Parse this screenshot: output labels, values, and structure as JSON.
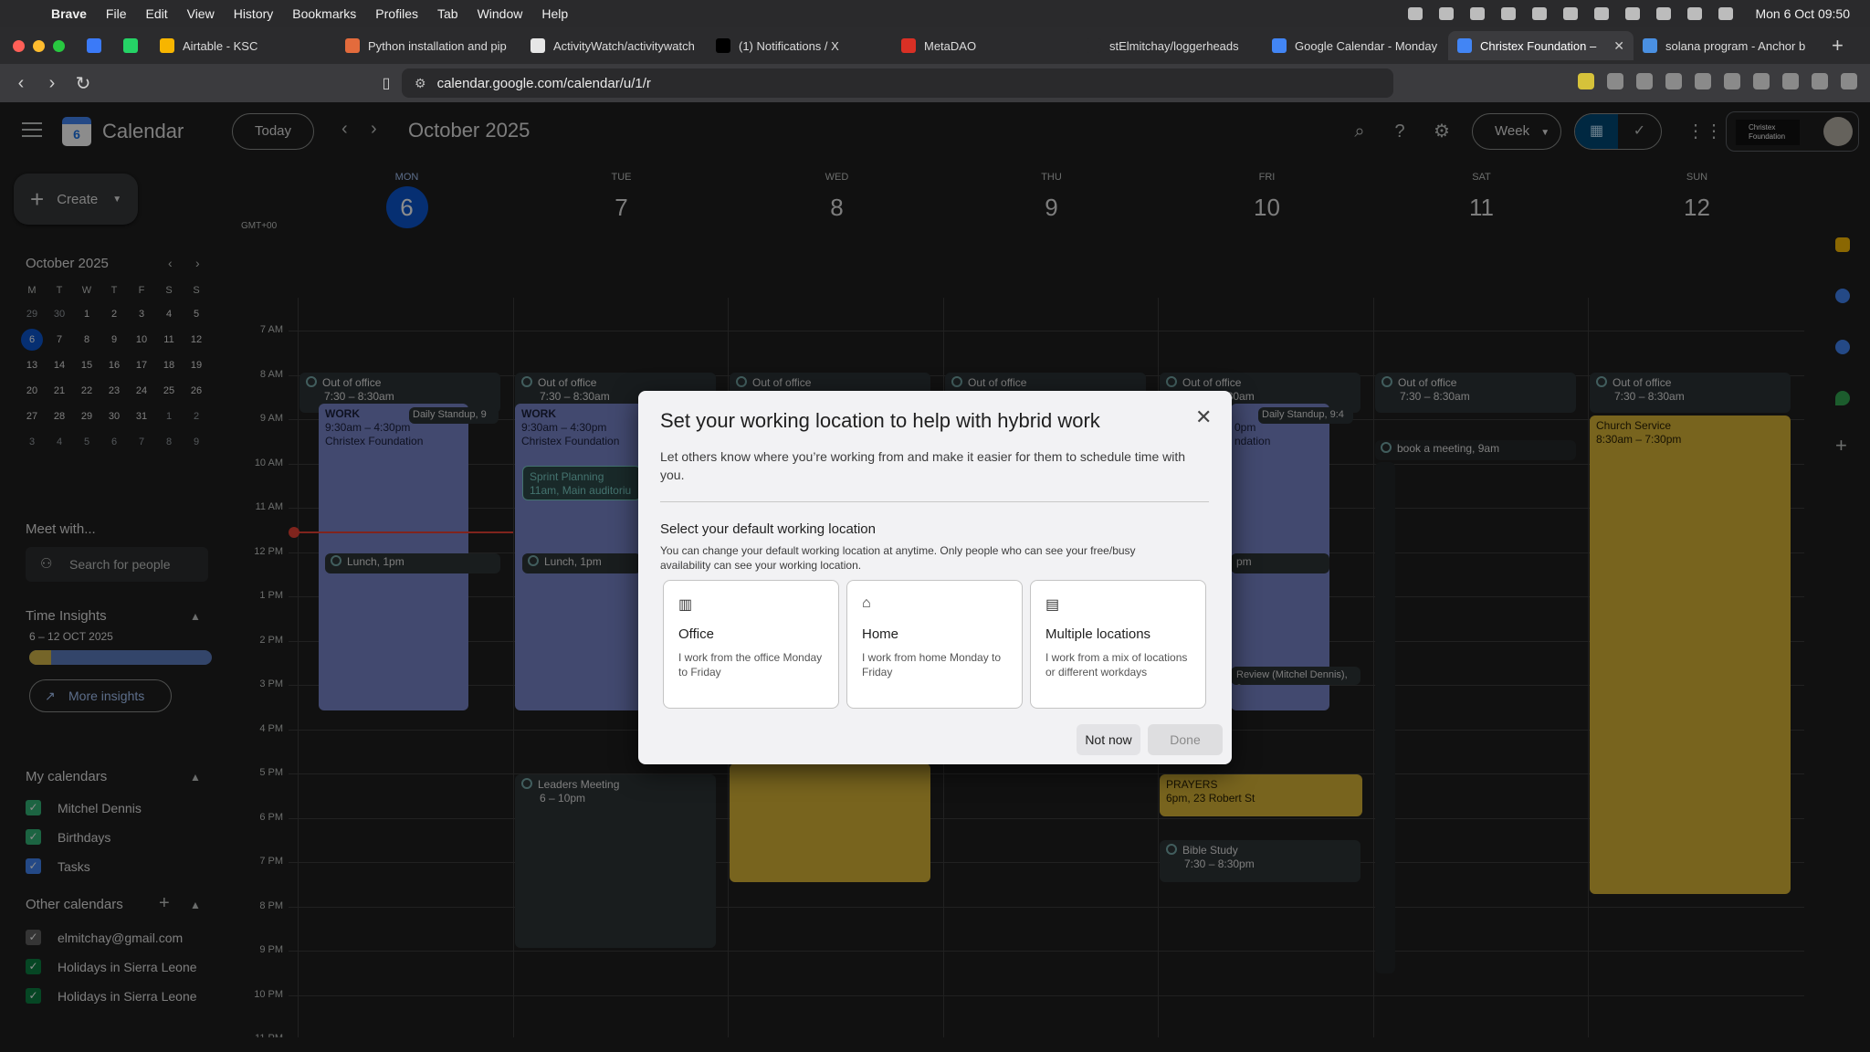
{
  "menubar": {
    "items": [
      "Brave",
      "File",
      "Edit",
      "View",
      "History",
      "Bookmarks",
      "Profiles",
      "Tab",
      "Window",
      "Help"
    ],
    "clock": "Mon 6 Oct  09:50"
  },
  "tabs": [
    {
      "label": "",
      "color": "#3b7af7"
    },
    {
      "label": "",
      "color": "#25d366"
    },
    {
      "label": "Airtable - KSC",
      "color": "#f7b500"
    },
    {
      "label": "Python installation and pip",
      "color": "#e36b3c"
    },
    {
      "label": "ActivityWatch/activitywatch",
      "color": "#e6e6e6"
    },
    {
      "label": "(1) Notifications / X",
      "color": "#000000"
    },
    {
      "label": "MetaDAO",
      "color": "#d93025"
    },
    {
      "label": "stElmitchay/loggerheads",
      "color": "#2b2b2d"
    },
    {
      "label": "Google Calendar - Monday",
      "color": "#4285f4"
    },
    {
      "label": "Christex Foundation –",
      "color": "#4285f4",
      "active": true
    },
    {
      "label": "solana program - Anchor b",
      "color": "#4a90e2"
    }
  ],
  "address": {
    "url": "calendar.google.com/calendar/u/1/r"
  },
  "header": {
    "app_title": "Calendar",
    "logo_day": "6",
    "today": "Today",
    "month": "October 2025",
    "view": "Week",
    "org_logo": "Christex Foundation"
  },
  "sidebar": {
    "create": "Create",
    "mini_month": "October 2025",
    "weekdays": [
      "M",
      "T",
      "W",
      "T",
      "F",
      "S",
      "S"
    ],
    "mini_weeks": [
      [
        "29",
        "30",
        "1",
        "2",
        "3",
        "4",
        "5"
      ],
      [
        "6",
        "7",
        "8",
        "9",
        "10",
        "11",
        "12"
      ],
      [
        "13",
        "14",
        "15",
        "16",
        "17",
        "18",
        "19"
      ],
      [
        "20",
        "21",
        "22",
        "23",
        "24",
        "25",
        "26"
      ],
      [
        "27",
        "28",
        "29",
        "30",
        "31",
        "1",
        "2"
      ],
      [
        "3",
        "4",
        "5",
        "6",
        "7",
        "8",
        "9"
      ]
    ],
    "meet_with": "Meet with...",
    "search_people": "Search for people",
    "time_insights": "Time Insights",
    "insights_range": "6 – 12 OCT 2025",
    "more_insights": "More insights",
    "my_calendars": "My calendars",
    "my_calendar_items": [
      {
        "label": "Mitchel Dennis",
        "color": "#33b679"
      },
      {
        "label": "Birthdays",
        "color": "#33b679"
      },
      {
        "label": "Tasks",
        "color": "#4285f4"
      }
    ],
    "other_calendars": "Other calendars",
    "other_calendar_items": [
      {
        "label": "elmitchay@gmail.com",
        "color": "#616161"
      },
      {
        "label": "Holidays in Sierra Leone",
        "color": "#0b8043"
      },
      {
        "label": "Holidays in Sierra Leone",
        "color": "#0b8043"
      }
    ]
  },
  "grid": {
    "gmt": "GMT+00",
    "days": [
      {
        "dow": "MON",
        "num": "6",
        "today": true
      },
      {
        "dow": "TUE",
        "num": "7"
      },
      {
        "dow": "WED",
        "num": "8"
      },
      {
        "dow": "THU",
        "num": "9"
      },
      {
        "dow": "FRI",
        "num": "10"
      },
      {
        "dow": "SAT",
        "num": "11"
      },
      {
        "dow": "SUN",
        "num": "12"
      }
    ],
    "hours": [
      "7 AM",
      "8 AM",
      "9 AM",
      "10 AM",
      "11 AM",
      "12 PM",
      "1 PM",
      "2 PM",
      "3 PM",
      "4 PM",
      "5 PM",
      "6 PM",
      "7 PM",
      "8 PM",
      "9 PM",
      "10 PM",
      "11 PM"
    ],
    "events": {
      "ooo_title": "Out of office",
      "ooo_time": "7:30 – 8:30am",
      "work_title": "WORK",
      "work_time": "9:30am – 4:30pm",
      "work_org": "Christex Foundation",
      "standup": "Daily Standup, 9",
      "standup_fri": "Daily Standup, 9:4",
      "sprint_title": "Sprint Planning",
      "sprint_sub": "11am, Main auditoriu",
      "lunch": "Lunch, 1pm",
      "fri_work_time": "0pm",
      "fri_work_org": "ndation",
      "fri_lunch": "pm",
      "review": "Review (Mitchel Dennis), 3",
      "book_meeting": "book a meeting, 9am",
      "church_title": "Church Service",
      "church_time": "8:30am – 7:30pm",
      "leaders_title": "Leaders Meeting",
      "leaders_time": "6 – 10pm",
      "prayers_title": "PRAYERS",
      "prayers_sub": "6pm, 23 Robert St",
      "bible_title": "Bible Study",
      "bible_time": "7:30 – 8:30pm"
    }
  },
  "dialog": {
    "title": "Set your working location to help with hybrid work",
    "description": "Let others know where you’re working from and make it easier for them to schedule time with you.",
    "subtitle": "Select your default working location",
    "note": "You can change your default working location at anytime. Only people who can see your free/busy availability can see your working location.",
    "options": [
      {
        "title": "Office",
        "desc": "I work from the office Monday to Friday",
        "icon": "building-icon"
      },
      {
        "title": "Home",
        "desc": "I work from home Monday to Friday",
        "icon": "home-icon"
      },
      {
        "title": "Multiple locations",
        "desc": "I work from a mix of locations or different workdays",
        "icon": "multiple-locations-icon"
      }
    ],
    "not_now": "Not now",
    "done": "Done"
  }
}
